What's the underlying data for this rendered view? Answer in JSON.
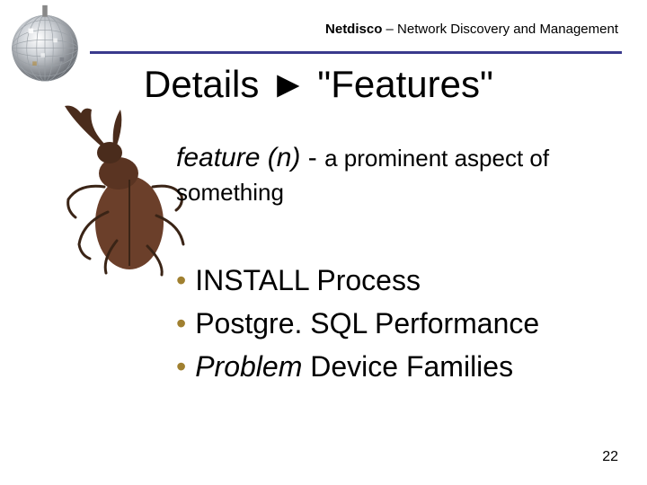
{
  "header": {
    "bold": "Netdisco",
    "rest": " – Network Discovery and Management"
  },
  "title": "Details ► \"Features\"",
  "definition": {
    "term": "feature (n)",
    "dash": " - ",
    "body1": "a prominent aspect of",
    "body2": "something"
  },
  "bullets": {
    "b1a": "INSTALL",
    "b1b": " Process",
    "b2": "Postgre. SQL Performance",
    "b3a": "Problem",
    "b3b": " Device Families"
  },
  "pagenum": "22"
}
